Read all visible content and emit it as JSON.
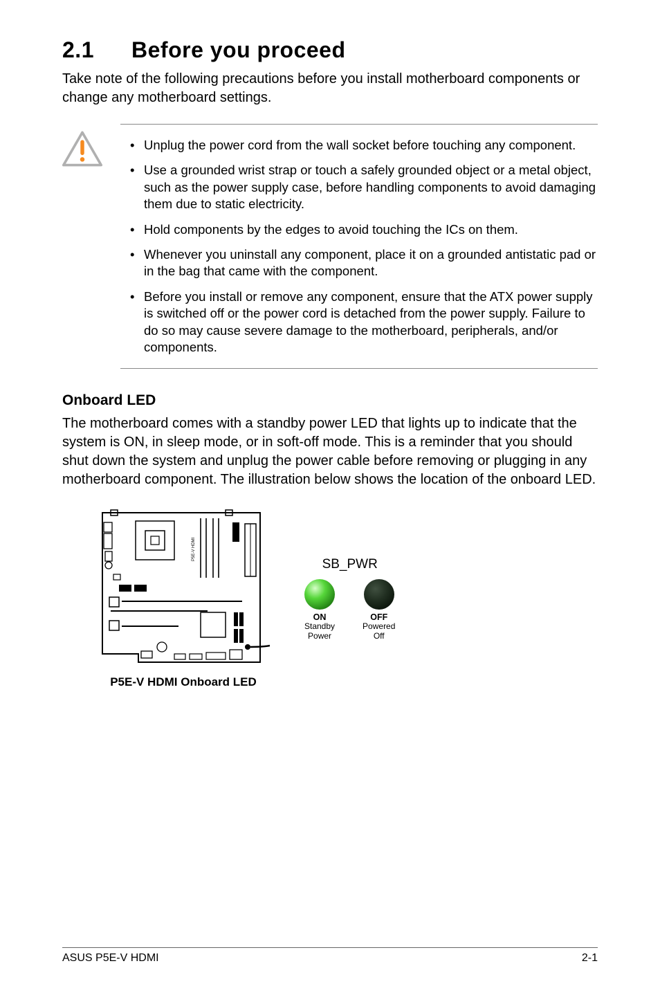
{
  "heading": {
    "number": "2.1",
    "title": "Before you proceed"
  },
  "intro": "Take note of the following precautions before you install motherboard components or change any motherboard settings.",
  "notices": [
    "Unplug the power cord from the wall socket before touching any component.",
    "Use a grounded wrist strap or touch a safely grounded object or a metal object, such as the power supply case, before handling components to avoid damaging them due to static electricity.",
    "Hold components by the edges to avoid touching the ICs on them.",
    "Whenever you uninstall any component, place it on a grounded antistatic pad or in the bag that came with the component.",
    "Before you install or remove any component, ensure that the ATX power supply is switched off or the power cord is detached from the power supply. Failure to do so may cause severe damage to the motherboard, peripherals, and/or components."
  ],
  "subhead": "Onboard LED",
  "body": "The motherboard comes with a standby power LED that lights up to indicate that the system is ON, in sleep mode, or in soft-off mode. This is a reminder that you should shut down the system and unplug the power cable before removing or plugging in any motherboard component. The illustration below shows the location of the onboard LED.",
  "diagram": {
    "board_caption": "P5E-V HDMI Onboard LED",
    "led_header": "SB_PWR",
    "on_label": "ON",
    "on_sub1": "Standby",
    "on_sub2": "Power",
    "off_label": "OFF",
    "off_sub1": "Powered",
    "off_sub2": "Off"
  },
  "footer": {
    "left": "ASUS P5E-V HDMI",
    "right": "2-1"
  }
}
